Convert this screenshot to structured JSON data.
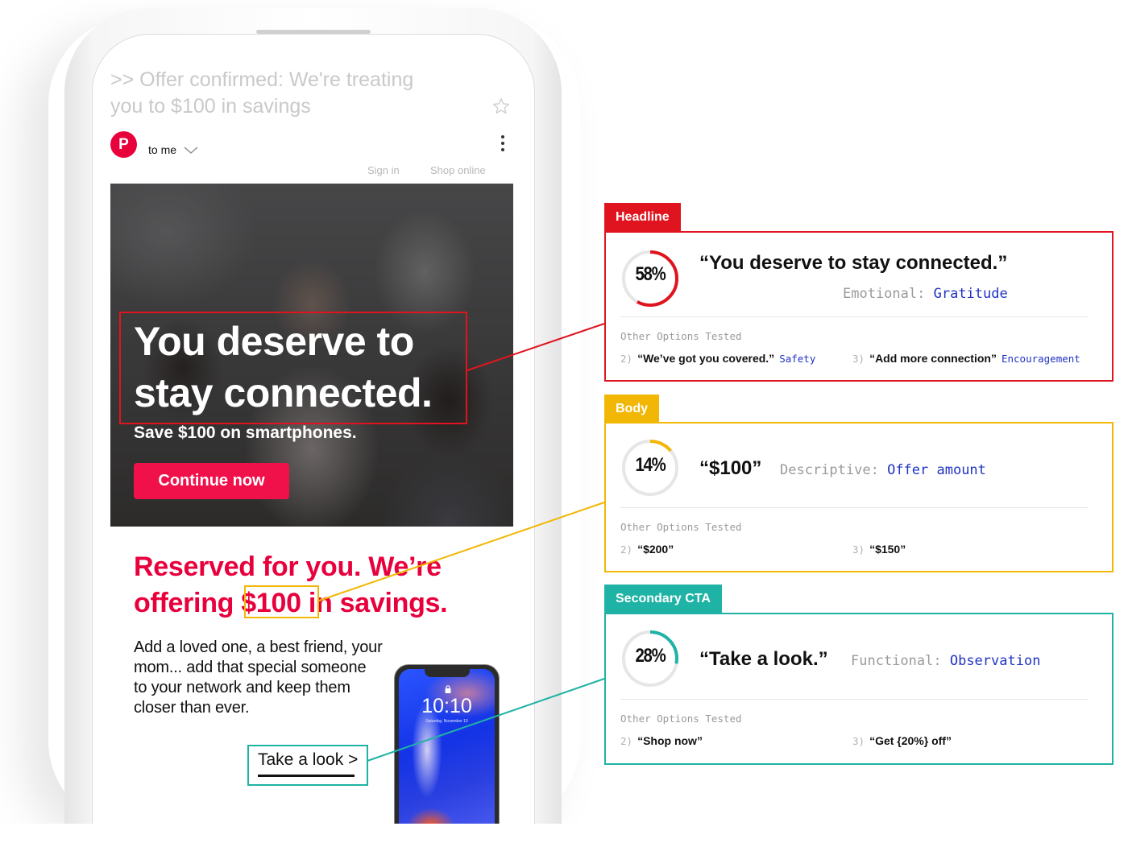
{
  "email": {
    "subject": ">> Offer confirmed: We're treating you to $100 in savings",
    "sender_initial": "P",
    "recipient_label": "to me",
    "links": [
      "Sign in",
      "Shop online"
    ],
    "icons": {
      "star": "star-outline-icon",
      "chevron": "chevron-down-icon",
      "more": "more-vertical-icon"
    },
    "hero": {
      "headline": "You deserve to stay connected.",
      "subheadline": "Save $100 on smartphones.",
      "cta_label": "Continue now"
    },
    "body_headline_before": "Reserved for you. We’re offering ",
    "body_headline_highlight": "$100",
    "body_headline_after": " in savings.",
    "body_paragraph": "Add a loved one, a best friend, your mom... add that special someone to your network and keep them closer than ever.",
    "secondary_cta_label": "Take a look >",
    "phone_image": {
      "time": "10:10",
      "date": "Saturday, November 10"
    }
  },
  "colors": {
    "brand": "#e8003d",
    "headline_accent": "#e0141e",
    "body_accent": "#f2b705",
    "cta_accent": "#1fb3a5",
    "category_value": "#2133c4"
  },
  "results": [
    {
      "section": "Headline",
      "winner_percent": 58,
      "winner_percent_label": "58%",
      "winner_text": "“You deserve to stay connected.”",
      "category_type": "Emotional:",
      "category_value": "Gratitude",
      "other_title": "Other Options Tested",
      "options": [
        {
          "num": "2)",
          "text": "“We’ve got you covered.”",
          "tag": "Safety"
        },
        {
          "num": "3)",
          "text": "“Add more connection”",
          "tag": "Encouragement"
        }
      ]
    },
    {
      "section": "Body",
      "winner_percent": 14,
      "winner_percent_label": "14%",
      "winner_text": "“$100”",
      "category_type": "Descriptive:",
      "category_value": "Offer amount",
      "other_title": "Other Options Tested",
      "options": [
        {
          "num": "2)",
          "text": "“$200”",
          "tag": ""
        },
        {
          "num": "3)",
          "text": "“$150”",
          "tag": ""
        }
      ]
    },
    {
      "section": "Secondary CTA",
      "winner_percent": 28,
      "winner_percent_label": "28%",
      "winner_text": "“Take a look.”",
      "category_type": "Functional:",
      "category_value": "Observation",
      "other_title": "Other Options Tested",
      "options": [
        {
          "num": "2)",
          "text": "“Shop now”",
          "tag": ""
        },
        {
          "num": "3)",
          "text": "“Get {20%} off”",
          "tag": ""
        }
      ]
    }
  ]
}
